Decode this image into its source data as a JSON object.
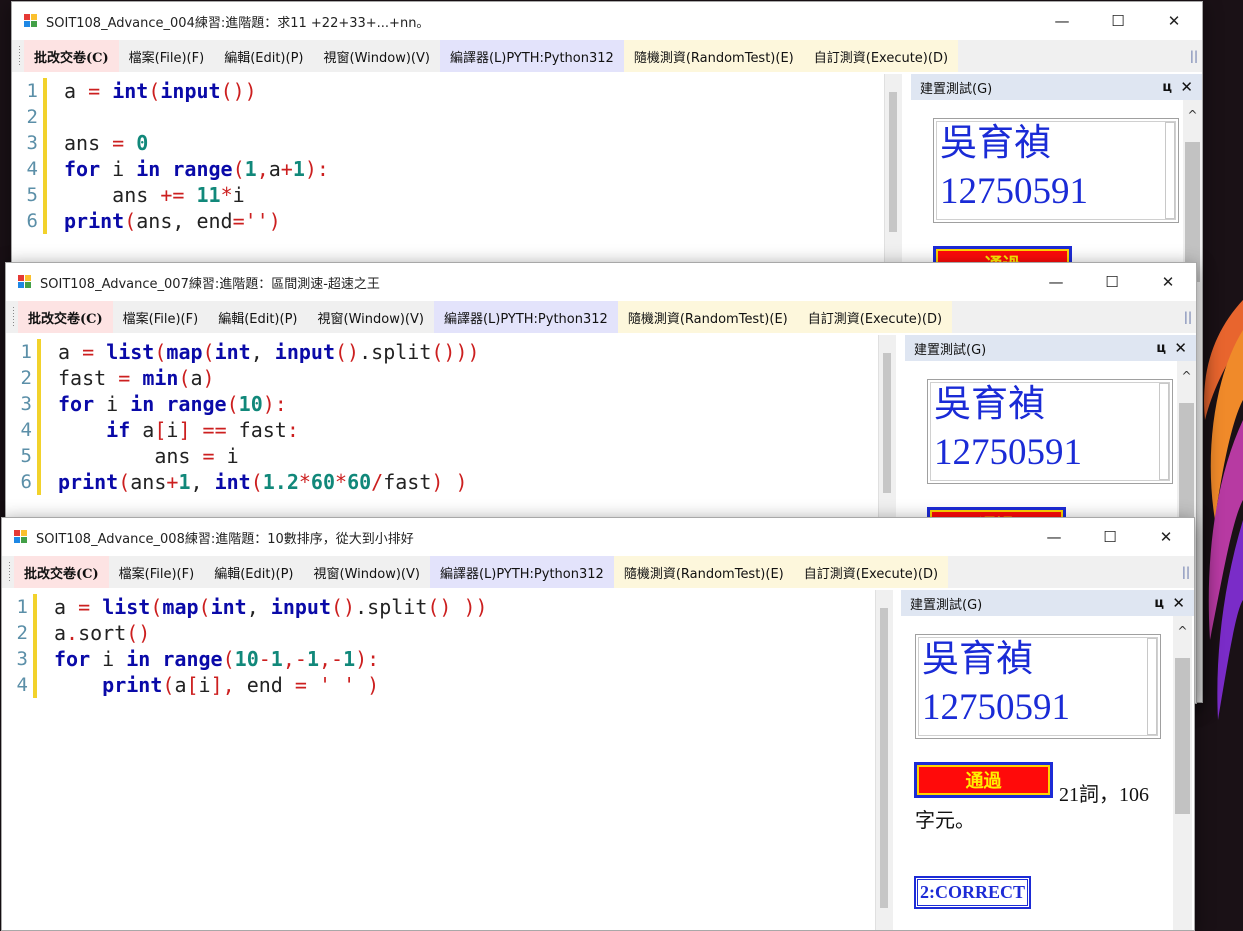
{
  "windows": [
    {
      "title": "SOIT108_Advance_004練習:進階題：求11 +22+33+...+nn。",
      "code_lines": [
        [
          [
            "",
            "a "
          ],
          [
            "op",
            "="
          ],
          [
            "",
            " "
          ],
          [
            "kw",
            "int"
          ],
          [
            "op",
            "("
          ],
          [
            "kw",
            "input"
          ],
          [
            "op",
            "())"
          ]
        ],
        [],
        [
          [
            "",
            "ans "
          ],
          [
            "op",
            "="
          ],
          [
            "",
            " "
          ],
          [
            "num",
            "0"
          ]
        ],
        [
          [
            "kw",
            "for"
          ],
          [
            "",
            " i "
          ],
          [
            "kw",
            "in"
          ],
          [
            "",
            " "
          ],
          [
            "kw",
            "range"
          ],
          [
            "op",
            "("
          ],
          [
            "num",
            "1"
          ],
          [
            "op",
            ","
          ],
          [
            "",
            "a"
          ],
          [
            "op",
            "+"
          ],
          [
            "num",
            "1"
          ],
          [
            "op",
            "):"
          ]
        ],
        [
          [
            "",
            "    ans "
          ],
          [
            "op",
            "+="
          ],
          [
            "",
            " "
          ],
          [
            "num",
            "11"
          ],
          [
            "op",
            "*"
          ],
          [
            "",
            "i"
          ]
        ],
        [
          [
            "kw",
            "print"
          ],
          [
            "op",
            "("
          ],
          [
            "",
            "ans, end"
          ],
          [
            "op",
            "="
          ],
          [
            "str",
            "''"
          ],
          [
            "op",
            ")"
          ]
        ]
      ]
    },
    {
      "title": "SOIT108_Advance_007練習:進階題：區間測速-超速之王",
      "code_lines": [
        [
          [
            "",
            "a "
          ],
          [
            "op",
            "="
          ],
          [
            "",
            " "
          ],
          [
            "kw",
            "list"
          ],
          [
            "op",
            "("
          ],
          [
            "kw",
            "map"
          ],
          [
            "op",
            "("
          ],
          [
            "kw",
            "int"
          ],
          [
            "",
            ", "
          ],
          [
            "kw",
            "input"
          ],
          [
            "op",
            "()"
          ],
          [
            "",
            ".split"
          ],
          [
            "op",
            "()))"
          ]
        ],
        [
          [
            "",
            "fast "
          ],
          [
            "op",
            "="
          ],
          [
            "",
            " "
          ],
          [
            "kw",
            "min"
          ],
          [
            "op",
            "("
          ],
          [
            "",
            "a"
          ],
          [
            "op",
            ")"
          ]
        ],
        [
          [
            "kw",
            "for"
          ],
          [
            "",
            " i "
          ],
          [
            "kw",
            "in"
          ],
          [
            "",
            " "
          ],
          [
            "kw",
            "range"
          ],
          [
            "op",
            "("
          ],
          [
            "num",
            "10"
          ],
          [
            "op",
            "):"
          ]
        ],
        [
          [
            "",
            "    "
          ],
          [
            "kw",
            "if"
          ],
          [
            "",
            " a"
          ],
          [
            "op",
            "["
          ],
          [
            "",
            "i"
          ],
          [
            "op",
            "]"
          ],
          [
            "",
            " "
          ],
          [
            "op",
            "=="
          ],
          [
            "",
            " fast"
          ],
          [
            "op",
            ":"
          ]
        ],
        [
          [
            "",
            "        ans "
          ],
          [
            "op",
            "="
          ],
          [
            "",
            " i"
          ]
        ],
        [
          [
            "kw",
            "print"
          ],
          [
            "op",
            "("
          ],
          [
            "",
            "ans"
          ],
          [
            "op",
            "+"
          ],
          [
            "num",
            "1"
          ],
          [
            "",
            ", "
          ],
          [
            "kw",
            "int"
          ],
          [
            "op",
            "("
          ],
          [
            "num",
            "1.2"
          ],
          [
            "op",
            "*"
          ],
          [
            "num",
            "60"
          ],
          [
            "op",
            "*"
          ],
          [
            "num",
            "60"
          ],
          [
            "op",
            "/"
          ],
          [
            "",
            "fast"
          ],
          [
            "op",
            ")"
          ],
          [
            "",
            " "
          ],
          [
            "op",
            ")"
          ]
        ]
      ]
    },
    {
      "title": "SOIT108_Advance_008練習:進階題：10數排序，從大到小排好",
      "code_lines": [
        [
          [
            "",
            "a "
          ],
          [
            "op",
            "="
          ],
          [
            "",
            " "
          ],
          [
            "kw",
            "list"
          ],
          [
            "op",
            "("
          ],
          [
            "kw",
            "map"
          ],
          [
            "op",
            "("
          ],
          [
            "kw",
            "int"
          ],
          [
            "",
            ", "
          ],
          [
            "kw",
            "input"
          ],
          [
            "op",
            "()"
          ],
          [
            "",
            ".split"
          ],
          [
            "op",
            "()"
          ],
          [
            "",
            " "
          ],
          [
            "op",
            "))"
          ]
        ],
        [
          [
            "",
            "a"
          ],
          [
            "op",
            "."
          ],
          [
            "",
            "sort"
          ],
          [
            "op",
            "()"
          ]
        ],
        [
          [
            "kw",
            "for"
          ],
          [
            "",
            " i "
          ],
          [
            "kw",
            "in"
          ],
          [
            "",
            " "
          ],
          [
            "kw",
            "range"
          ],
          [
            "op",
            "("
          ],
          [
            "num",
            "10"
          ],
          [
            "op",
            "-"
          ],
          [
            "num",
            "1"
          ],
          [
            "op",
            ",-"
          ],
          [
            "num",
            "1"
          ],
          [
            "op",
            ",-"
          ],
          [
            "num",
            "1"
          ],
          [
            "op",
            "):"
          ]
        ],
        [
          [
            "",
            "    "
          ],
          [
            "kw",
            "print"
          ],
          [
            "op",
            "("
          ],
          [
            "",
            "a"
          ],
          [
            "op",
            "["
          ],
          [
            "",
            "i"
          ],
          [
            "op",
            "],"
          ],
          [
            "",
            " end "
          ],
          [
            "op",
            "="
          ],
          [
            "",
            " "
          ],
          [
            "str",
            "' '"
          ],
          [
            "",
            " "
          ],
          [
            "op",
            ")"
          ]
        ]
      ]
    }
  ],
  "menu": {
    "grade": "批改交卷(C)",
    "file": "檔案(File)(F)",
    "edit": "編輯(Edit)(P)",
    "window": "視窗(Window)(V)",
    "compiler": "編譯器(L)PYTH:Python312",
    "random": "隨機測資(RandomTest)(E)",
    "execute": "自訂測資(Execute)(D)",
    "overflow": "||"
  },
  "window_buttons": {
    "minimize": "—",
    "maximize": "☐",
    "close": "✕"
  },
  "panel": {
    "title": "建置測試(G)",
    "pin": "ц",
    "close": "✕",
    "student_name": "吳育禎",
    "student_id": "12750591",
    "pass_label": "通過",
    "result_text": "21詞，106字元。",
    "result_part1": "21詞，106",
    "result_part2": "字元。",
    "correct_label": "2:CORRECT",
    "scroll_up": "^"
  },
  "colors": {
    "keyword": "#0a0aa8",
    "operator": "#cc1f1f",
    "number": "#11887a",
    "badge_red": "#ff0a0a",
    "badge_border": "#1d2bd6",
    "gutter_bar": "#f2d22b"
  }
}
